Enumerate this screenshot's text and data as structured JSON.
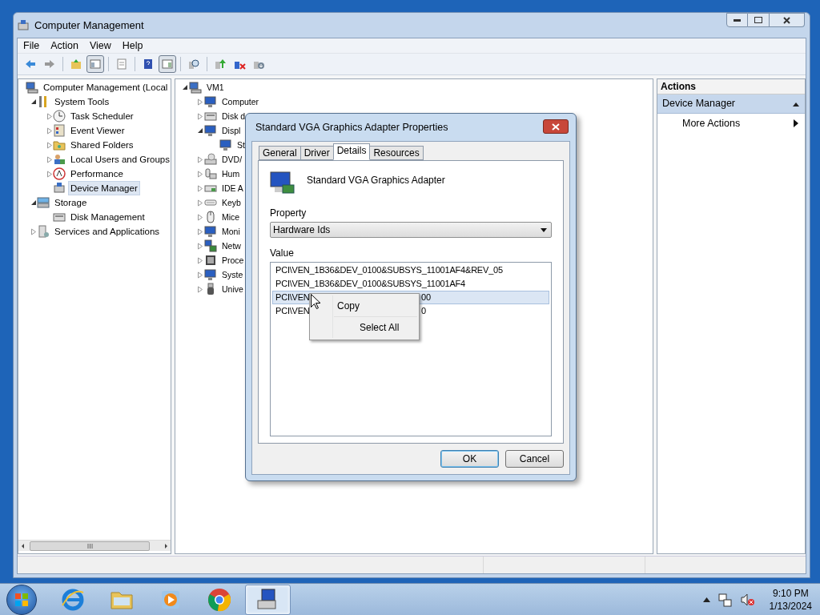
{
  "window": {
    "title": "Computer Management",
    "menu": [
      "File",
      "Action",
      "View",
      "Help"
    ],
    "toolbar": [
      [
        {
          "pressed": false
        },
        {
          "pressed": false
        }
      ],
      [
        {
          "pressed": false
        },
        {
          "pressed": true
        }
      ],
      [
        {
          "pressed": false
        }
      ],
      [
        {
          "pressed": false
        },
        {
          "pressed": true
        }
      ],
      [
        {
          "pressed": false
        }
      ],
      [
        {
          "pressed": false
        },
        {
          "pressed": false
        },
        {
          "pressed": false
        }
      ]
    ]
  },
  "nav_tree": [
    {
      "label": "Computer Management (Local",
      "selected": false,
      "children": [
        {
          "label": "System Tools",
          "expanded": true,
          "selected": false,
          "children": [
            {
              "label": "Task Scheduler",
              "expanded": false,
              "selected": false
            },
            {
              "label": "Event Viewer",
              "expanded": false,
              "selected": false
            },
            {
              "label": "Shared Folders",
              "expanded": false,
              "selected": false
            },
            {
              "label": "Local Users and Groups",
              "expanded": false,
              "selected": false
            },
            {
              "label": "Performance",
              "expanded": false,
              "selected": false
            },
            {
              "label": "Device Manager",
              "selected": true
            }
          ]
        },
        {
          "label": "Storage",
          "expanded": true,
          "selected": false,
          "children": [
            {
              "label": "Disk Management",
              "selected": false
            }
          ]
        },
        {
          "label": "Services and Applications",
          "expanded": false,
          "selected": false
        }
      ]
    }
  ],
  "device_tree": [
    {
      "label": "VM1",
      "expanded": true,
      "children": [
        {
          "label": "Computer",
          "expanded": false
        },
        {
          "label": "Disk d",
          "expanded": false
        },
        {
          "label": "Displ",
          "expanded": true,
          "children": [
            {
              "label": "St"
            }
          ]
        },
        {
          "label": "DVD/",
          "expanded": false
        },
        {
          "label": "Hum",
          "expanded": false
        },
        {
          "label": "IDE A",
          "expanded": false
        },
        {
          "label": "Keyb",
          "expanded": false
        },
        {
          "label": "Mice",
          "expanded": false
        },
        {
          "label": "Moni",
          "expanded": false
        },
        {
          "label": "Netw",
          "expanded": false
        },
        {
          "label": "Proce",
          "expanded": false
        },
        {
          "label": "Syste",
          "expanded": false
        },
        {
          "label": "Unive",
          "expanded": false
        }
      ]
    }
  ],
  "actions": {
    "title": "Actions",
    "sections": [
      {
        "label": "Device Manager",
        "expanded": true,
        "items": [
          "More Actions"
        ]
      }
    ]
  },
  "dialog": {
    "title": "Standard VGA Graphics Adapter Properties",
    "tabs": [
      {
        "label": "General",
        "selected": false
      },
      {
        "label": "Driver",
        "selected": false
      },
      {
        "label": "Details",
        "selected": true
      },
      {
        "label": "Resources",
        "selected": false
      }
    ],
    "device_name": "Standard VGA Graphics Adapter",
    "property_label": "Property",
    "property_value": "Hardware Ids",
    "value_label": "Value",
    "values": [
      {
        "text": "PCI\\VEN_1B36&DEV_0100&SUBSYS_11001AF4&REV_05",
        "selected": false
      },
      {
        "text": "PCI\\VEN_1B36&DEV_0100&SUBSYS_11001AF4",
        "selected": false
      },
      {
        "text": "PCI\\VEN",
        "tail": "00",
        "selected": true
      },
      {
        "text": "PCI\\VEN",
        "tail": "0",
        "selected": false
      }
    ],
    "buttons": [
      {
        "label": "OK",
        "default": true
      },
      {
        "label": "Cancel",
        "default": false
      }
    ]
  },
  "context_menu": {
    "items": [
      "Copy",
      "Select All"
    ]
  },
  "taskbar": {
    "apps": [
      {
        "active": false
      },
      {
        "active": false
      },
      {
        "active": false
      },
      {
        "active": false
      },
      {
        "active": true
      }
    ],
    "clock": {
      "time": "9:10 PM",
      "date": "1/13/2024"
    }
  }
}
